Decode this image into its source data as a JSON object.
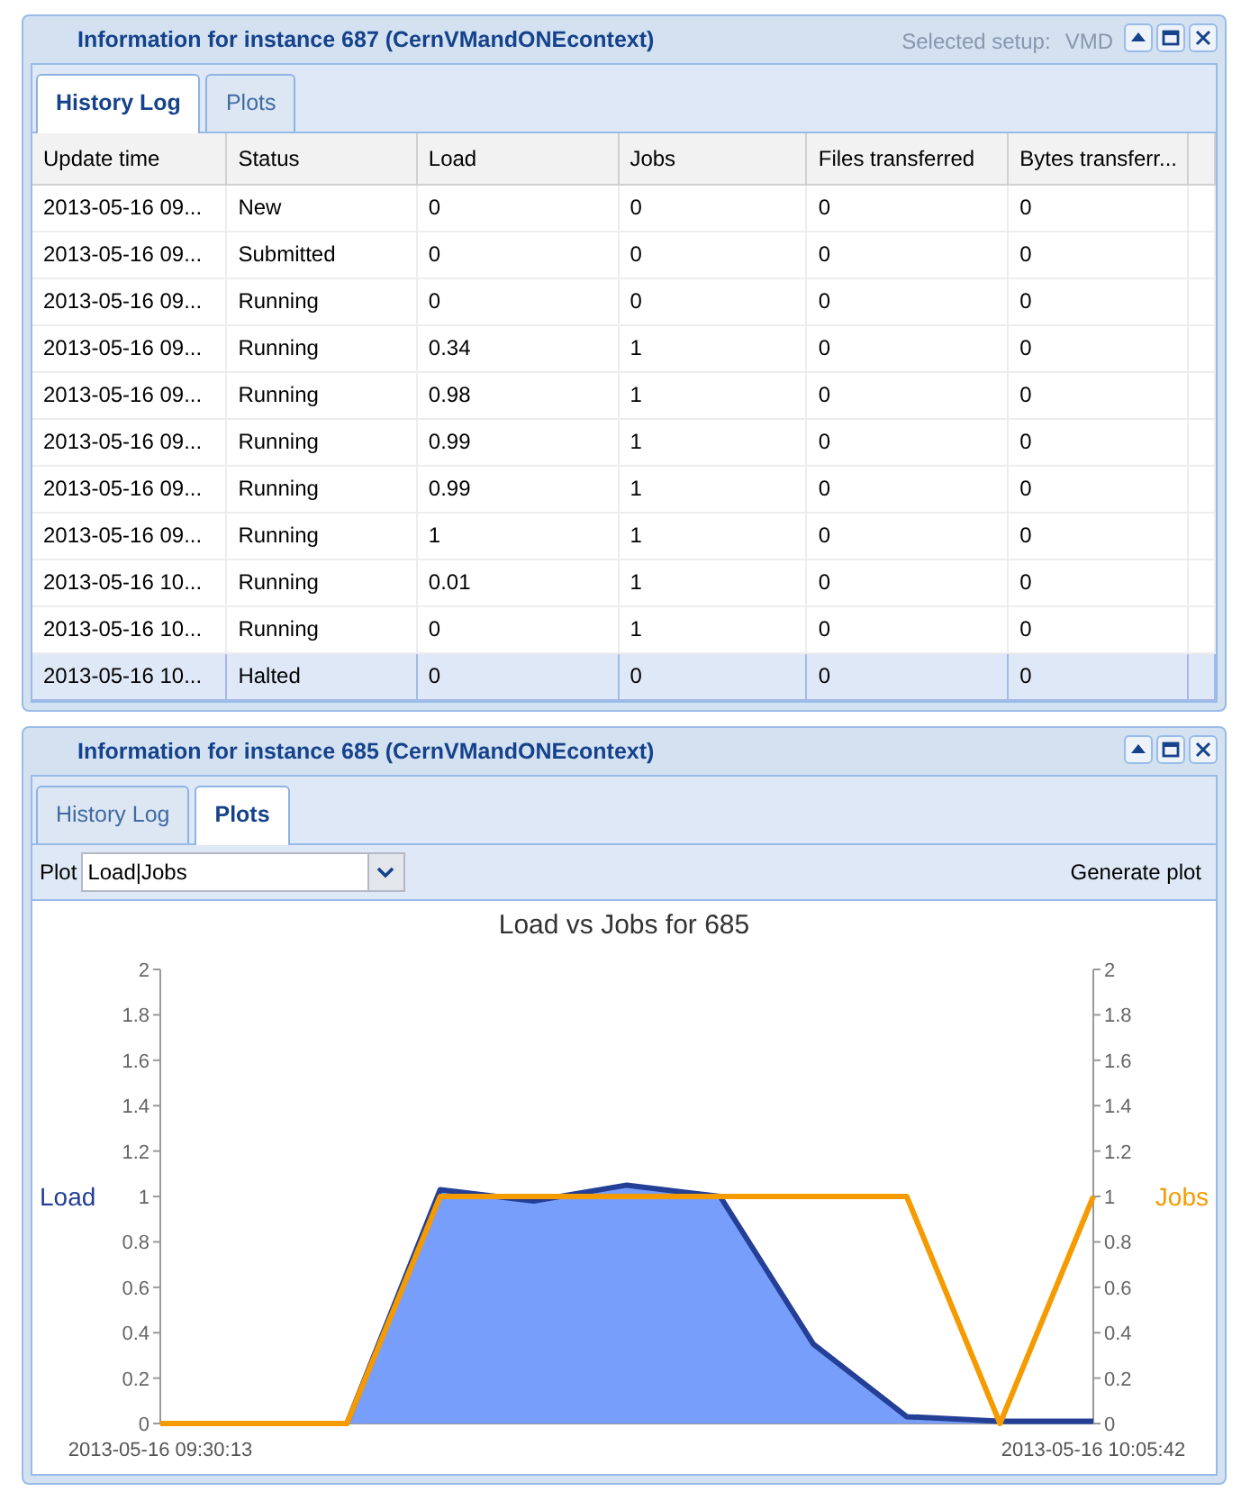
{
  "windows": [
    {
      "title": "Information for instance 687 (CernVMandONEcontext)",
      "background_text": [
        "Selected setup:",
        "VMD"
      ],
      "tabs": [
        {
          "label": "History Log",
          "selected": true
        },
        {
          "label": "Plots",
          "selected": false
        }
      ],
      "table": {
        "columns": [
          "Update time",
          "Status",
          "Load",
          "Jobs",
          "Files transferred",
          "Bytes transferr..."
        ],
        "rows": [
          {
            "cells": [
              "2013-05-16 09...",
              "New",
              "0",
              "0",
              "0",
              "0"
            ],
            "selected": false
          },
          {
            "cells": [
              "2013-05-16 09...",
              "Submitted",
              "0",
              "0",
              "0",
              "0"
            ],
            "selected": false
          },
          {
            "cells": [
              "2013-05-16 09...",
              "Running",
              "0",
              "0",
              "0",
              "0"
            ],
            "selected": false
          },
          {
            "cells": [
              "2013-05-16 09...",
              "Running",
              "0.34",
              "1",
              "0",
              "0"
            ],
            "selected": false
          },
          {
            "cells": [
              "2013-05-16 09...",
              "Running",
              "0.98",
              "1",
              "0",
              "0"
            ],
            "selected": false
          },
          {
            "cells": [
              "2013-05-16 09...",
              "Running",
              "0.99",
              "1",
              "0",
              "0"
            ],
            "selected": false
          },
          {
            "cells": [
              "2013-05-16 09...",
              "Running",
              "0.99",
              "1",
              "0",
              "0"
            ],
            "selected": false
          },
          {
            "cells": [
              "2013-05-16 09...",
              "Running",
              "1",
              "1",
              "0",
              "0"
            ],
            "selected": false
          },
          {
            "cells": [
              "2013-05-16 10...",
              "Running",
              "0.01",
              "1",
              "0",
              "0"
            ],
            "selected": false
          },
          {
            "cells": [
              "2013-05-16 10...",
              "Running",
              "0",
              "1",
              "0",
              "0"
            ],
            "selected": false
          },
          {
            "cells": [
              "2013-05-16 10...",
              "Halted",
              "0",
              "0",
              "0",
              "0"
            ],
            "selected": true
          }
        ]
      }
    },
    {
      "title": "Information for instance 685 (CernVMandONEcontext)",
      "tabs": [
        {
          "label": "History Log",
          "selected": false
        },
        {
          "label": "Plots",
          "selected": true
        }
      ],
      "plot_label": "Plot",
      "plot_select": "Load|Jobs",
      "generate_button": "Generate plot",
      "chart_data": {
        "type": "area",
        "title": "Load vs Jobs for 685",
        "categories": [
          "2013-05-16 09:30:13",
          null,
          null,
          null,
          null,
          null,
          null,
          null,
          null,
          null,
          "2013-05-16 10:05:42"
        ],
        "series": [
          {
            "name": "Load",
            "type": "area",
            "color": "#233f96",
            "values": [
              0,
              0,
              0,
              1.03,
              0.98,
              1.05,
              1.0,
              0.35,
              0.03,
              0.01,
              0.01
            ]
          },
          {
            "name": "Jobs",
            "type": "line",
            "color": "#f59b00",
            "values": [
              0,
              0,
              0,
              1,
              1,
              1,
              1,
              1,
              1,
              0,
              1
            ]
          }
        ],
        "ylim": [
          0,
          2
        ],
        "yticks": [
          0,
          0.2,
          0.4,
          0.6,
          0.8,
          1,
          1.2,
          1.4,
          1.6,
          1.8,
          2
        ],
        "y2lim": [
          0,
          2
        ],
        "y2ticks": [
          0,
          0.2,
          0.4,
          0.6,
          0.8,
          1,
          1.2,
          1.4,
          1.6,
          1.8,
          2
        ]
      }
    }
  ]
}
